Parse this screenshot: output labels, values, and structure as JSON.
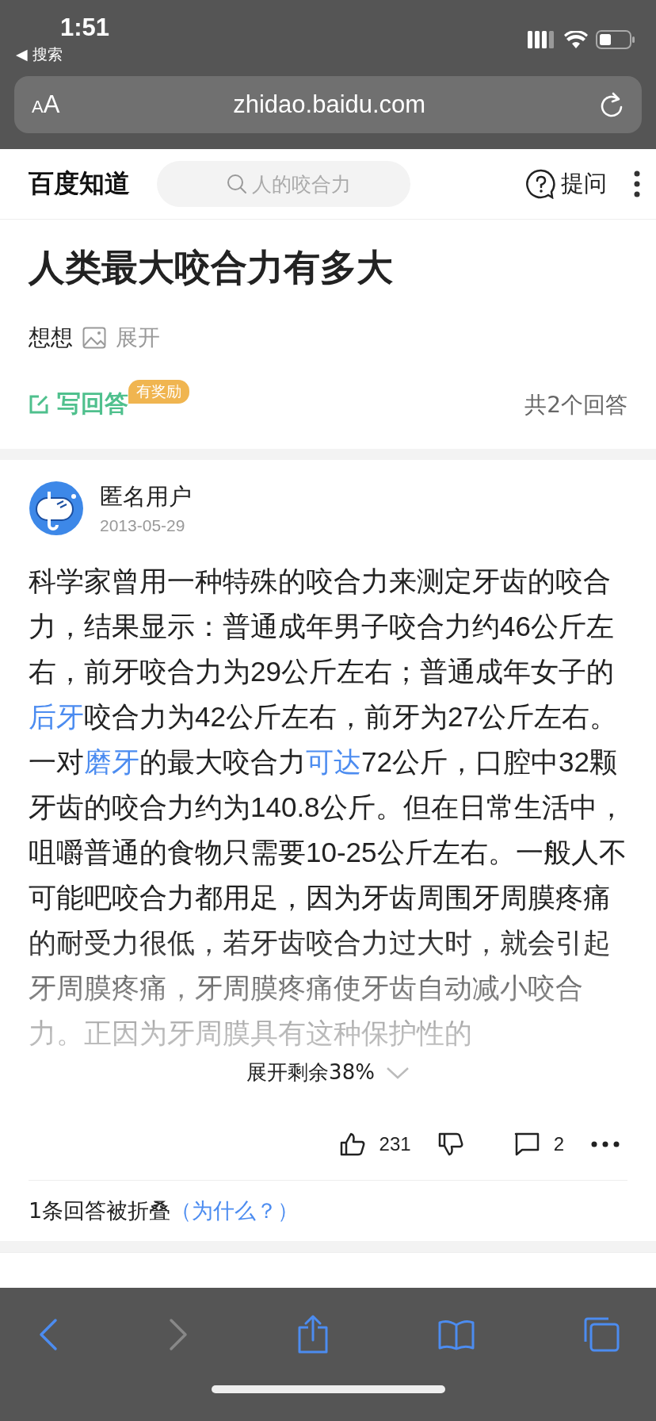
{
  "status_bar": {
    "time": "1:51",
    "back_label": "◀ 搜索"
  },
  "browser": {
    "text_size_label": "AA",
    "url": "zhidao.baidu.com"
  },
  "header": {
    "logo": "百度知道",
    "search": {
      "placeholder": "人的咬合力"
    },
    "ask_label": "提问"
  },
  "question": {
    "title": "人类最大咬合力有多大",
    "asker": "想想",
    "expand_label": "展开",
    "write_answer_label": "写回答",
    "reward_badge": "有奖励",
    "answer_count": "共2个回答"
  },
  "answer": {
    "user": "匿名用户",
    "date": "2013-05-29",
    "body": [
      {
        "kind": "text",
        "text": "科学家曾用一种特殊的咬合力来测定牙齿的咬合力，结果显示：普通成年男子咬合力约46公斤左右，前牙咬合力为29公斤左右；普通成年女子的"
      },
      {
        "kind": "link",
        "text": "后牙"
      },
      {
        "kind": "text",
        "text": "咬合力为42公斤左右，前牙为27公斤左右。一对"
      },
      {
        "kind": "link",
        "text": "磨牙"
      },
      {
        "kind": "text",
        "text": "的最大咬合力"
      },
      {
        "kind": "link",
        "text": "可达"
      },
      {
        "kind": "text",
        "text": "72公斤，口腔中32颗牙齿的咬合力约为140.8公斤。但在日常生活中，咀嚼普通的食物只需要10-25公斤左右。一般人不可能吧咬合力都用足，因为牙齿周围牙周膜疼痛的耐受力很低，若牙齿咬合力过大时，就会引起牙周膜疼痛，牙周膜疼痛使牙齿自动减小咬合力。正因为牙周膜具有这种保护性的"
      }
    ],
    "expand_more": "展开剩余38%",
    "likes": "231",
    "comments": "2"
  },
  "folded": {
    "text": "1条回答被折叠",
    "link": "（为什么？）"
  }
}
